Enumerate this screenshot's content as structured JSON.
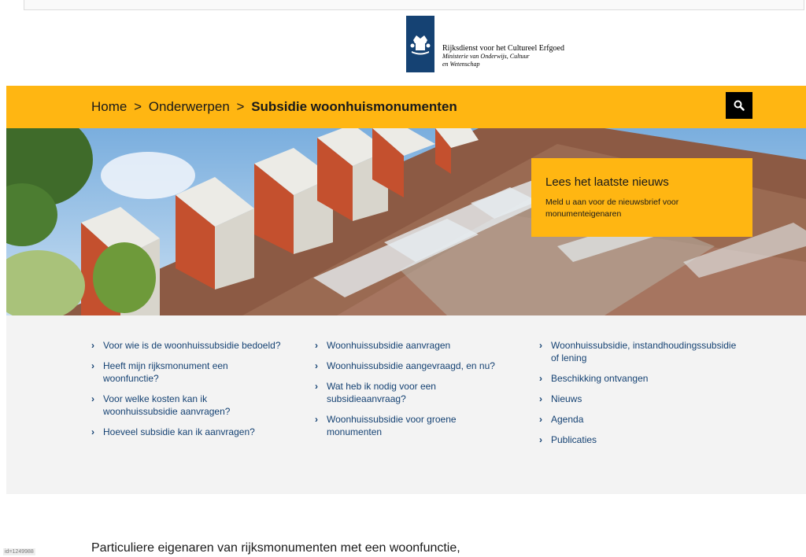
{
  "logo": {
    "org_name": "Rijksdienst voor het Cultureel Erfgoed",
    "ministry": "Ministerie van Onderwijs, Cultuur en Wetenschap"
  },
  "breadcrumb": {
    "home": "Home",
    "separator": ">",
    "topics": "Onderwerpen",
    "current": "Subsidie woonhuismonumenten"
  },
  "news_box": {
    "title": "Lees het laatste nieuws",
    "text": "Meld u aan voor de nieuwsbrief voor monumenteigenaren"
  },
  "links": {
    "chevron": "›",
    "col1": [
      "Voor wie is de woonhuissubsidie bedoeld?",
      "Heeft mijn rijksmonument een woonfunctie?",
      "Voor welke kosten kan ik woonhuissubsidie aanvragen?",
      "Hoeveel subsidie kan ik aanvragen?"
    ],
    "col2": [
      "Woonhuissubsidie aanvragen",
      "Woonhuissubsidie aangevraagd, en nu?",
      "Wat heb ik nodig voor een subsidieaanvraag?",
      "Woonhuissubsidie voor groene monumenten"
    ],
    "col3": [
      "Woonhuissubsidie, instandhoudingssubsidie of lening",
      "Beschikking ontvangen",
      "Nieuws",
      "Agenda",
      "Publicaties"
    ]
  },
  "intro_text": "Particuliere eigenaren van rijksmonumenten met een woonfunctie,",
  "id_label": "id=1249988",
  "icons": {
    "search": "search-icon",
    "chevron": "chevron-right-icon",
    "logo": "crest-icon"
  },
  "colors": {
    "accent": "#ffb612",
    "brand": "#154273",
    "panel": "#f3f3f3",
    "link": "#154273"
  }
}
